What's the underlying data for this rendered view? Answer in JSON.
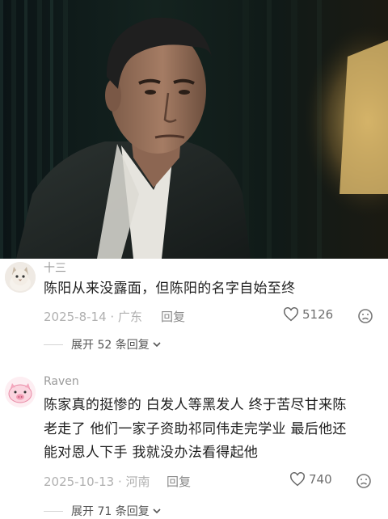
{
  "comments": [
    {
      "username": "十三",
      "text": "陈阳从来没露面，但陈阳的名字自始至终",
      "date_location": "2025-8-14 · 广东",
      "reply_label": "回复",
      "likes": "5126",
      "expand_label": "展开 52 条回复"
    },
    {
      "username": "Raven",
      "text_lines": [
        "陈家真的挺惨的 白发人等黑发人 终于苦尽甘来陈",
        "老走了 他们一家子资助祁同伟走完学业 最后他还",
        "能对恩人下手 我就没办法看得起他"
      ],
      "date_location": "2025-10-13 · 河南",
      "reply_label": "回复",
      "likes": "740",
      "expand_label": "展开 71 条回复"
    }
  ],
  "icons": {
    "like": "heart-outline-icon",
    "dislike": "frown-face-icon",
    "expand": "chevron-down-icon"
  },
  "colors": {
    "username": "#9a9a9a",
    "body": "#1e1e1e",
    "meta": "#b0b0b0"
  }
}
